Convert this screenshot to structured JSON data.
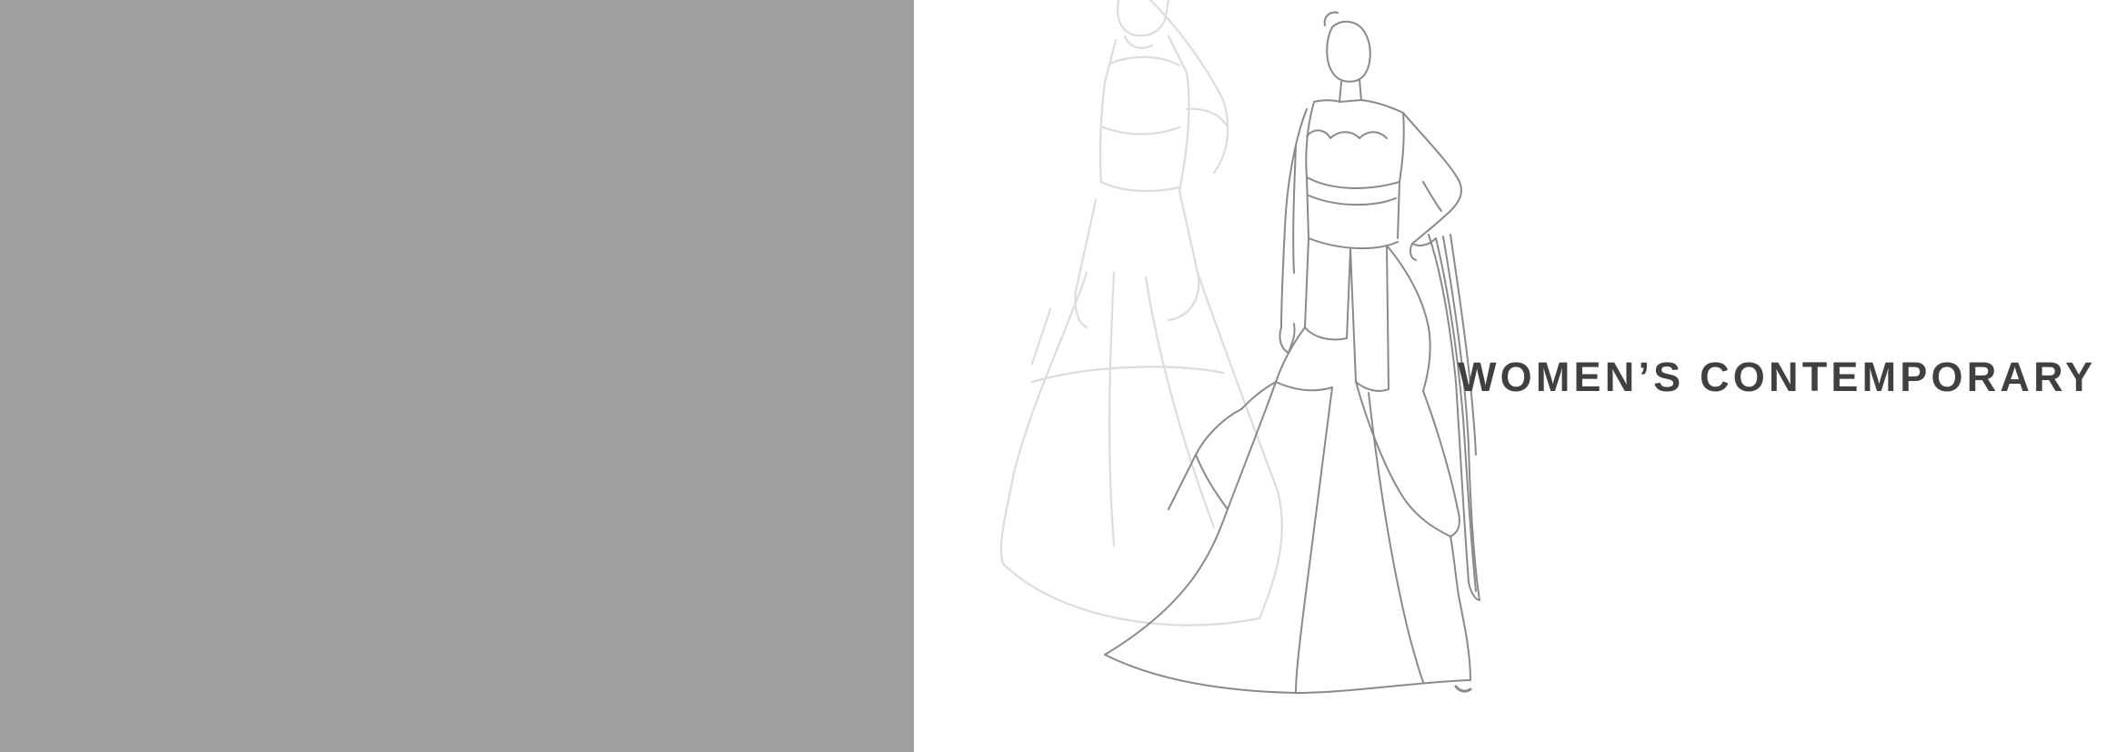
{
  "banner": {
    "title": "WOMEN’S CONTEMPORARY"
  },
  "colors": {
    "left_panel": "#9f9f9f",
    "background": "#ffffff",
    "title_text": "#404040",
    "sketch_front": "#8a8a8a",
    "sketch_back": "#dcdcdc"
  },
  "illustration": {
    "icon": "fashion-sketch-gown"
  }
}
